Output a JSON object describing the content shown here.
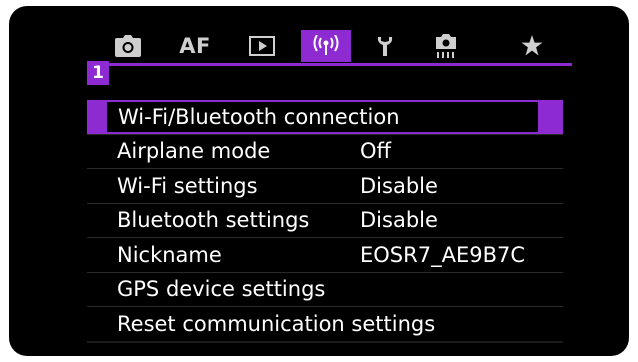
{
  "tabs": [
    {
      "name": "camera-icon",
      "active": false
    },
    {
      "name": "af-tab",
      "label": "AF",
      "active": false
    },
    {
      "name": "playback-icon",
      "active": false
    },
    {
      "name": "wireless-icon",
      "active": true
    },
    {
      "name": "wrench-icon",
      "active": false
    },
    {
      "name": "custom-functions-icon",
      "active": false
    },
    {
      "name": "star-icon",
      "active": false
    }
  ],
  "colors": {
    "accent": "#8e2ad1",
    "background": "#000000",
    "text": "#ffffff"
  },
  "subtab": {
    "label": "1"
  },
  "menu": {
    "items": [
      {
        "label": "Wi-Fi/Bluetooth connection",
        "value": "",
        "selected": true
      },
      {
        "label": "Airplane mode",
        "value": "Off"
      },
      {
        "label": "Wi-Fi settings",
        "value": "Disable"
      },
      {
        "label": "Bluetooth settings",
        "value": "Disable"
      },
      {
        "label": "Nickname",
        "value": "EOSR7_AE9B7C"
      },
      {
        "label": "GPS device settings",
        "value": ""
      },
      {
        "label": "Reset communication settings",
        "value": ""
      }
    ]
  }
}
